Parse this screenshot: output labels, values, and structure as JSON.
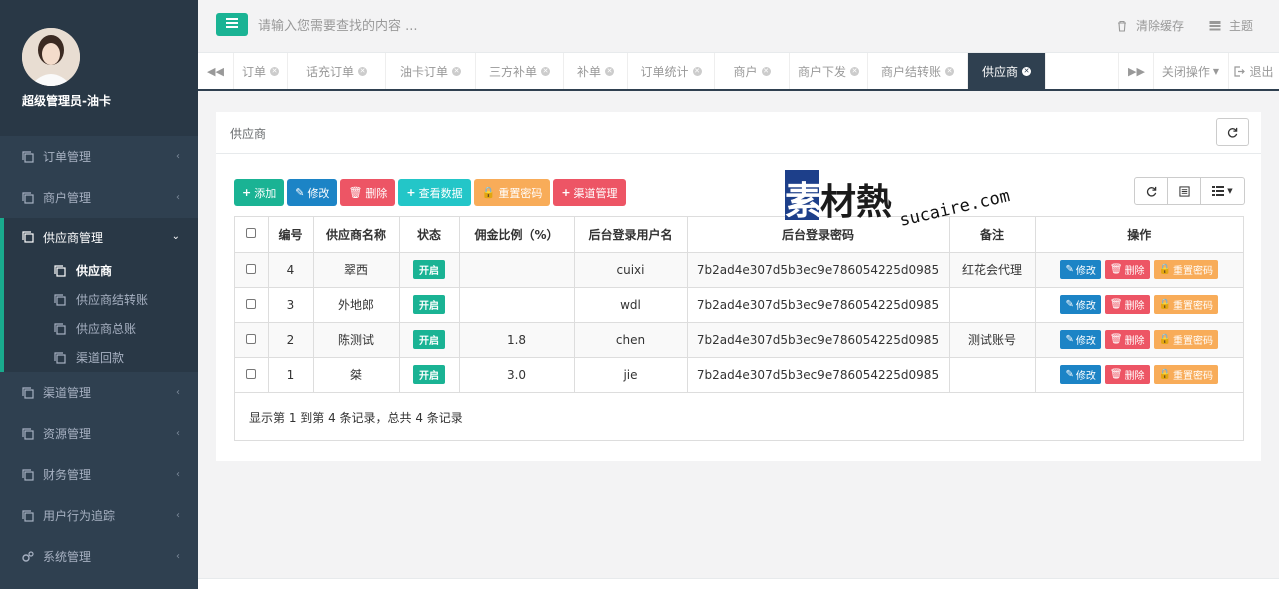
{
  "search": {
    "placeholder": "请输入您需要查找的内容 ..."
  },
  "topbar": {
    "clear_cache": "清除缓存",
    "theme": "主题"
  },
  "profile": {
    "name": "超级管理员-油卡"
  },
  "sidebar": {
    "items_before": [
      {
        "label": "订单管理",
        "icon": "copy-icon"
      },
      {
        "label": "商户管理",
        "icon": "copy-icon"
      }
    ],
    "group": {
      "label": "供应商管理",
      "subitems": [
        "供应商",
        "供应商结转账",
        "供应商总账",
        "渠道回款"
      ]
    },
    "items_after": [
      {
        "label": "渠道管理",
        "icon": "copy-icon"
      },
      {
        "label": "资源管理",
        "icon": "copy-icon"
      },
      {
        "label": "财务管理",
        "icon": "copy-icon"
      },
      {
        "label": "用户行为追踪",
        "icon": "copy-icon"
      },
      {
        "label": "系统管理",
        "icon": "gears-icon"
      }
    ]
  },
  "tabs": [
    "订单",
    "话充订单",
    "油卡订单",
    "三方补单",
    "补单",
    "订单统计",
    "商户",
    "商户下发",
    "商户结转账",
    "供应商"
  ],
  "tabbar": {
    "close_ops": "关闭操作",
    "logout": "退出"
  },
  "panel": {
    "title": "供应商",
    "toolbar": {
      "add": "添加",
      "edit": "修改",
      "delete": "删除",
      "view": "查看数据",
      "reset_pwd": "重置密码",
      "channel": "渠道管理"
    },
    "table": {
      "headers": [
        "编号",
        "供应商名称",
        "状态",
        "佣金比例（%）",
        "后台登录用户名",
        "后台登录密码",
        "备注",
        "操作"
      ],
      "rows": [
        {
          "id": "4",
          "name": "翠西",
          "status": "开启",
          "rate": "",
          "username": "cuixi",
          "password": "7b2ad4e307d5b3ec9e786054225d0985",
          "note": "红花会代理"
        },
        {
          "id": "3",
          "name": "外地郎",
          "status": "开启",
          "rate": "",
          "username": "wdl",
          "password": "7b2ad4e307d5b3ec9e786054225d0985",
          "note": ""
        },
        {
          "id": "2",
          "name": "陈测试",
          "status": "开启",
          "rate": "1.8",
          "username": "chen",
          "password": "7b2ad4e307d5b3ec9e786054225d0985",
          "note": "测试账号"
        },
        {
          "id": "1",
          "name": "桀",
          "status": "开启",
          "rate": "3.0",
          "username": "jie",
          "password": "7b2ad4e307d5b3ec9e786054225d0985",
          "note": ""
        }
      ],
      "row_ops": {
        "edit": "修改",
        "delete": "删除",
        "reset": "重置密码"
      },
      "footer": "显示第 1 到第 4 条记录，总共 4 条记录"
    }
  },
  "watermark": {
    "cn": "素材熱",
    "en": "sucaire.com"
  },
  "colors": {
    "sidebar": "#2f4050",
    "accent": "#1ab394",
    "blue": "#1c84c6",
    "red": "#ed5565",
    "teal": "#23c6c8",
    "orange": "#f8ac59"
  }
}
